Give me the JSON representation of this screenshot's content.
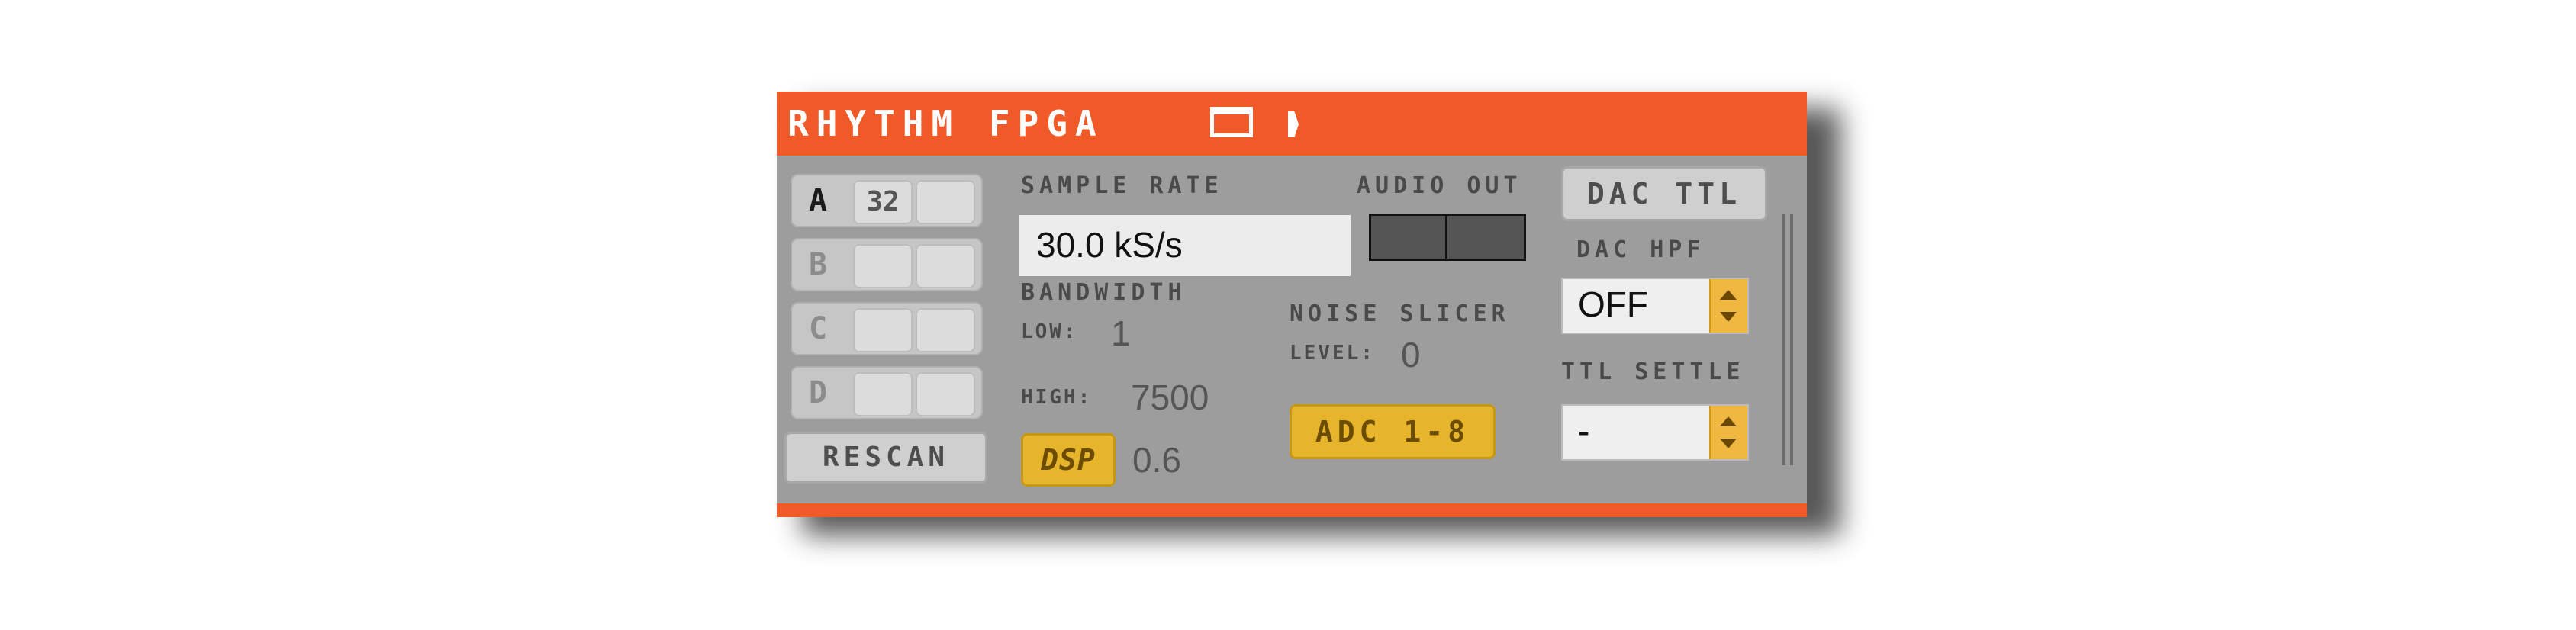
{
  "title": "RHYTHM FPGA",
  "headstages": [
    {
      "letter": "A",
      "slot1": "32",
      "slot2": "",
      "active": true
    },
    {
      "letter": "B",
      "slot1": "",
      "slot2": "",
      "active": false
    },
    {
      "letter": "C",
      "slot1": "",
      "slot2": "",
      "active": false
    },
    {
      "letter": "D",
      "slot1": "",
      "slot2": "",
      "active": false
    }
  ],
  "rescan_label": "RESCAN",
  "sample_rate": {
    "label": "SAMPLE RATE",
    "value": "30.0 kS/s"
  },
  "bandwidth": {
    "label": "BANDWIDTH",
    "low_label": "LOW:",
    "low_value": "1",
    "high_label": "HIGH:",
    "high_value": "7500"
  },
  "dsp": {
    "label": "DSP",
    "value": "0.6"
  },
  "audio_out": {
    "label": "AUDIO OUT"
  },
  "noise_slicer": {
    "label": "NOISE SLICER",
    "level_label": "LEVEL:",
    "level_value": "0"
  },
  "adc_button": "ADC 1-8",
  "dac_ttl_button": "DAC TTL",
  "dac_hpf": {
    "label": "DAC HPF",
    "value": "OFF"
  },
  "ttl_settle": {
    "label": "TTL SETTLE",
    "value": "-"
  },
  "colors": {
    "title_bar": "#f05a28",
    "panel": "#9d9d9d",
    "accent_button": "#e6b52c"
  },
  "icons": [
    "window-icon",
    "expand-arrow-icon",
    "select-arrows-icon"
  ]
}
